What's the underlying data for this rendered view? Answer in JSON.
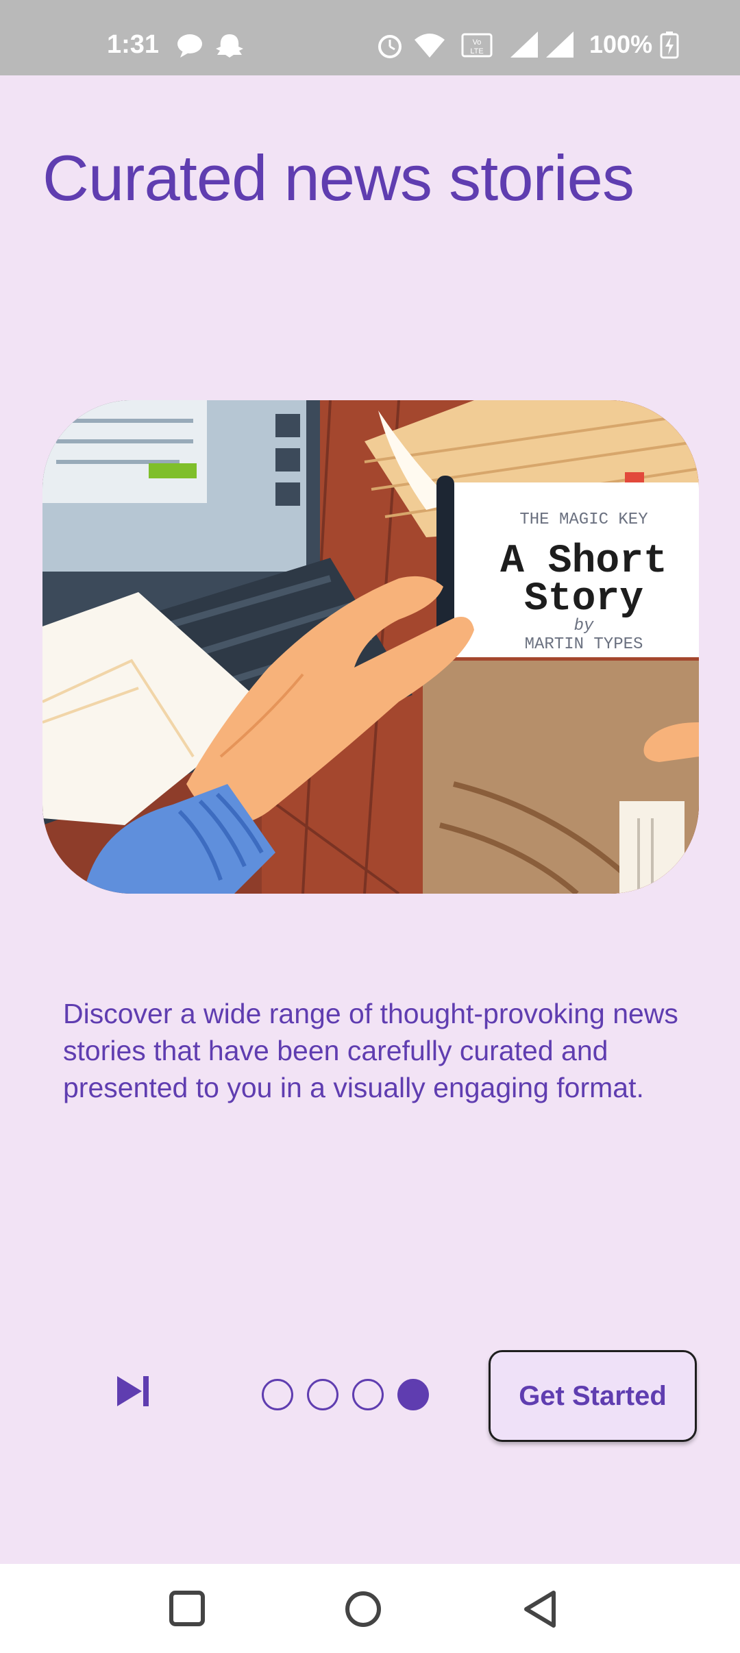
{
  "status_bar": {
    "time": "1:31",
    "battery": "100%",
    "icons": [
      "chat-icon",
      "snapchat-icon",
      "alarm-icon",
      "wifi-icon",
      "volte-icon",
      "signal-icon",
      "signal-icon",
      "battery-charging-icon"
    ]
  },
  "onboarding": {
    "title": "Curated news stories",
    "description": "Discover a wide range of thought-provoking news stories that have been carefully curated and presented to you in a visually engaging format.",
    "skip_icon": "skip-next-icon",
    "page_indicator": {
      "current": 4,
      "total": 4
    },
    "get_started_label": "Get Started"
  },
  "illustration": {
    "book_series": "THE MAGIC KEY",
    "book_title_line1": "A Short",
    "book_title_line2": "Story",
    "book_by": "by",
    "book_author": "MARTIN TYPES"
  },
  "nav_bar": {
    "icons": [
      "recents-icon",
      "home-icon",
      "back-icon"
    ]
  },
  "colors": {
    "accent": "#5f3db0",
    "background": "#f2e3f5",
    "button_fill": "#efe1f8"
  }
}
